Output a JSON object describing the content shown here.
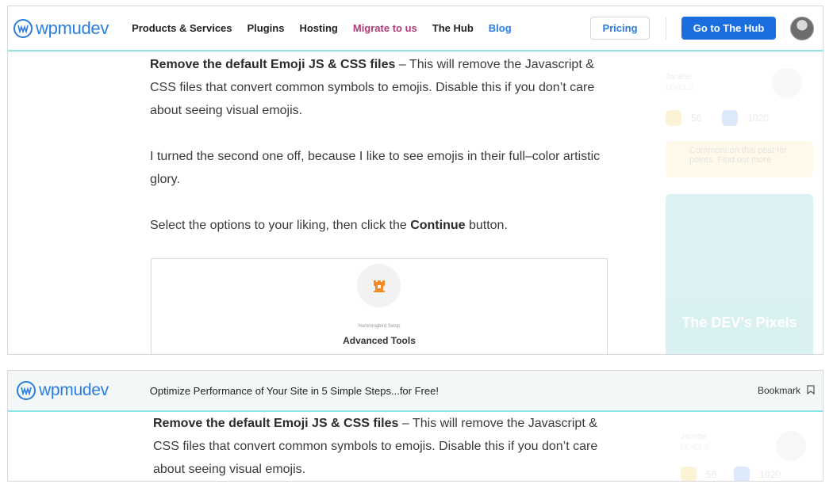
{
  "brand": {
    "name": "wpmudev",
    "logo_icon": "wpmudev-logo-icon",
    "color": "#2a7de1"
  },
  "nav": {
    "links": [
      {
        "label": "Products & Services"
      },
      {
        "label": "Plugins"
      },
      {
        "label": "Hosting"
      },
      {
        "label": "Migrate to us"
      },
      {
        "label": "The Hub"
      },
      {
        "label": "Blog"
      }
    ],
    "pricing_label": "Pricing",
    "hub_button_label": "Go to The Hub",
    "hub_button_color": "#1a6ee0"
  },
  "article": {
    "p1_bold": "Remove the default Emoji JS & CSS files",
    "p1_text": " – This will remove the Javascript & CSS files that convert common symbols to emojis. Disable this if you don’t care about seeing visual emojis.",
    "p2": "I turned the second one off, because I like to see emojis in their full–color artistic glory.",
    "p3_before": "Select the options to your liking, then click the ",
    "p3_bold": "Continue",
    "p3_after": " button."
  },
  "screenshot": {
    "small_label": "Hummingbird Setup",
    "title": "Advanced Tools",
    "icon": "hummingbird-castle-icon"
  },
  "sidebar": {
    "author_name": "Janette",
    "author_level": "LEVEL 6",
    "stat_1": "56",
    "stat_2": "1020",
    "note_text": "Comment on this post for points. Find out more",
    "card_title": "The DEV's Pixels"
  },
  "sticky": {
    "title": "Optimize Performance of Your Site in 5 Simple Steps...for Free!",
    "bookmark_label": "Bookmark",
    "bookmark_icon": "bookmark-icon"
  }
}
